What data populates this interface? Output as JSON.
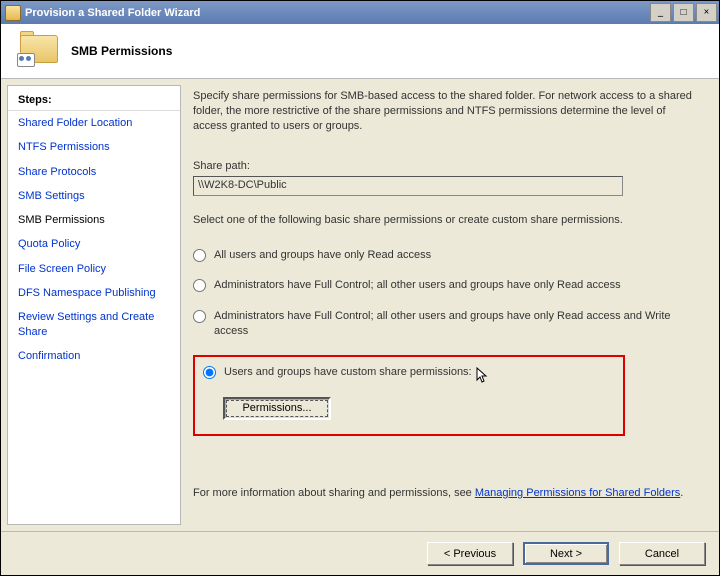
{
  "window": {
    "title": "Provision a Shared Folder Wizard"
  },
  "header": {
    "title": "SMB Permissions"
  },
  "sidebar": {
    "title": "Steps:",
    "items": [
      {
        "label": "Shared Folder Location",
        "current": false
      },
      {
        "label": "NTFS Permissions",
        "current": false
      },
      {
        "label": "Share Protocols",
        "current": false
      },
      {
        "label": "SMB Settings",
        "current": false
      },
      {
        "label": "SMB Permissions",
        "current": true
      },
      {
        "label": "Quota Policy",
        "current": false
      },
      {
        "label": "File Screen Policy",
        "current": false
      },
      {
        "label": "DFS Namespace Publishing",
        "current": false
      },
      {
        "label": "Review Settings and Create Share",
        "current": false
      },
      {
        "label": "Confirmation",
        "current": false
      }
    ]
  },
  "content": {
    "description": "Specify share permissions for SMB-based access to the shared folder. For network access to a shared folder, the more restrictive of the share permissions and NTFS permissions determine the level of access granted to users or groups.",
    "sharepath_label": "Share path:",
    "sharepath_value": "\\\\W2K8-DC\\Public",
    "instruction": "Select one of the following basic share permissions or create custom share permissions.",
    "options": [
      "All users and groups have only Read access",
      "Administrators have Full Control; all other users and groups have only Read access",
      "Administrators have Full Control; all other users and groups have only Read access and Write access",
      "Users and groups have custom share permissions:"
    ],
    "selected_option": 3,
    "permissions_button": "Permissions...",
    "moreinfo_pre": "For more information about sharing and permissions, see ",
    "moreinfo_link": "Managing Permissions for Shared Folders",
    "moreinfo_post": "."
  },
  "footer": {
    "previous": "< Previous",
    "next": "Next >",
    "cancel": "Cancel"
  }
}
